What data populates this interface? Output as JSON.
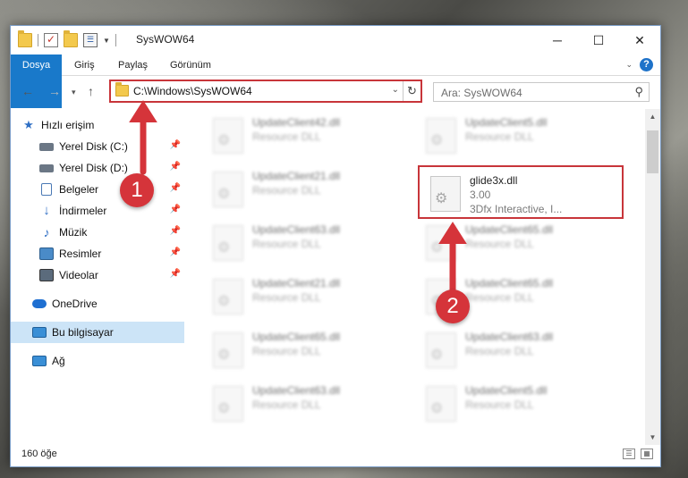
{
  "window": {
    "title": "SysWOW64"
  },
  "ribbon": {
    "tabs": [
      "Dosya",
      "Giriş",
      "Paylaş",
      "Görünüm"
    ]
  },
  "address": {
    "path": "C:\\Windows\\SysWOW64"
  },
  "search": {
    "placeholder": "Ara: SysWOW64"
  },
  "sidebar": {
    "items": [
      {
        "label": "Hızlı erişim",
        "icon": "star-icon",
        "color": "#2f6fc4",
        "pinned": false
      },
      {
        "label": "Yerel Disk (C:)",
        "icon": "drive-icon",
        "color": "#6b7785",
        "pinned": true
      },
      {
        "label": "Yerel Disk (D:)",
        "icon": "drive-icon",
        "color": "#6b7785",
        "pinned": true
      },
      {
        "label": "Belgeler",
        "icon": "documents-icon",
        "color": "#4a79b5",
        "pinned": true
      },
      {
        "label": "İndirmeler",
        "icon": "download-icon",
        "color": "#2f6fc4",
        "pinned": true
      },
      {
        "label": "Müzik",
        "icon": "music-icon",
        "color": "#2f6fc4",
        "pinned": true
      },
      {
        "label": "Resimler",
        "icon": "pictures-icon",
        "color": "#4a8bc8",
        "pinned": true
      },
      {
        "label": "Videolar",
        "icon": "videos-icon",
        "color": "#5b6b7c",
        "pinned": true
      },
      {
        "label": "OneDrive",
        "icon": "cloud-icon",
        "color": "#1e6fd1",
        "pinned": false
      },
      {
        "label": "Bu bilgisayar",
        "icon": "computer-icon",
        "color": "#3a8fd6",
        "pinned": false
      },
      {
        "label": "Ağ",
        "icon": "network-icon",
        "color": "#3a8fd6",
        "pinned": false
      }
    ]
  },
  "files": [
    {
      "name": "UpdateClient42.dll",
      "sub": "Resource DLL",
      "blurred": true
    },
    {
      "name": "UpdateClient5.dll",
      "sub": "Resource DLL",
      "blurred": true
    },
    {
      "name": "UpdateClient21.dll",
      "sub": "Resource DLL",
      "blurred": true
    },
    {
      "name": "glide3x.dll",
      "sub": "3.00",
      "sub2": "3Dfx Interactive, I...",
      "blurred": false
    },
    {
      "name": "UpdateClient63.dll",
      "sub": "Resource DLL",
      "blurred": true
    },
    {
      "name": "UpdateClient65.dll",
      "sub": "Resource DLL",
      "blurred": true
    },
    {
      "name": "UpdateClient21.dll",
      "sub": "Resource DLL",
      "blurred": true
    },
    {
      "name": "UpdateClient65.dll",
      "sub": "Resource DLL",
      "blurred": true
    },
    {
      "name": "UpdateClient65.dll",
      "sub": "Resource DLL",
      "blurred": true
    },
    {
      "name": "UpdateClient63.dll",
      "sub": "Resource DLL",
      "blurred": true
    },
    {
      "name": "UpdateClient63.dll",
      "sub": "Resource DLL",
      "blurred": true
    },
    {
      "name": "UpdateClient5.dll",
      "sub": "Resource DLL",
      "blurred": true
    }
  ],
  "status": {
    "count": "160 öğe"
  },
  "annotations": {
    "callout1": "1",
    "callout2": "2",
    "highlight_color": "#c8353a"
  }
}
